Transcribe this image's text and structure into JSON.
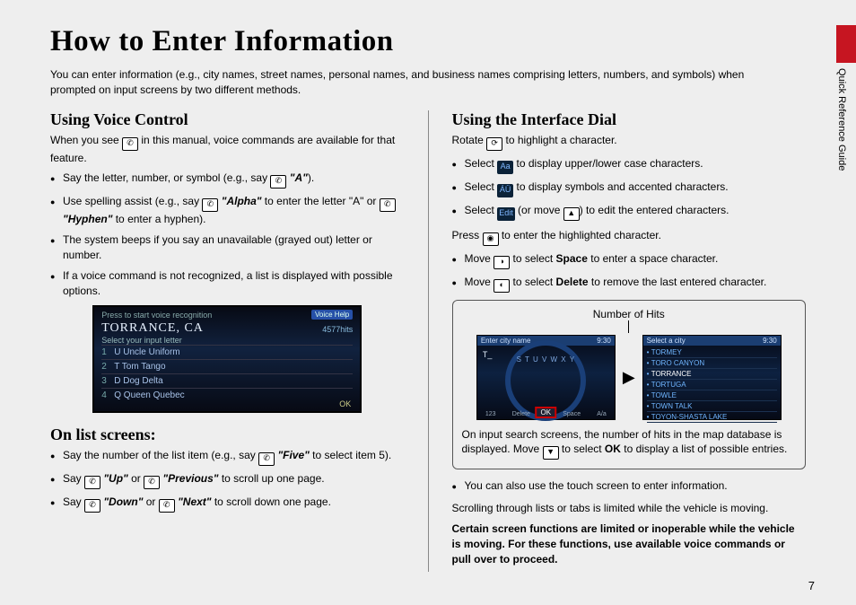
{
  "tab_label": "Quick Reference Guide",
  "page_number": "7",
  "title": "How to Enter Information",
  "intro": "You can enter information (e.g., city names, street names, personal names, and business names comprising letters, numbers, and symbols) when prompted on input screens by two different methods.",
  "left": {
    "h_voice": "Using Voice Control",
    "voice_intro_a": "When you see ",
    "voice_intro_b": " in this manual, voice commands are available for that feature.",
    "vb1_a": "Say the letter, number, or symbol (e.g., say ",
    "vb1_cmd": "\"A\"",
    "vb1_b": ").",
    "vb2_a": "Use spelling assist (e.g., say ",
    "vb2_cmd1": "\"Alpha\"",
    "vb2_mid": " to enter the letter \"A\" or ",
    "vb2_cmd2": "\"Hyphen\"",
    "vb2_b": " to enter a hyphen).",
    "vb3": "The system beeps if you say an unavailable (grayed out) letter or number.",
    "vb4": "If a voice command is not recognized, a list is displayed with possible options.",
    "shot": {
      "bar": "Press    to start voice recognition",
      "voice_help": "Voice Help",
      "city": "TORRANCE, CA",
      "hits": "4577hits",
      "sub": "Select your input letter",
      "rows": [
        {
          "n": "1",
          "t": "U Uncle Uniform"
        },
        {
          "n": "2",
          "t": "T Tom Tango"
        },
        {
          "n": "3",
          "t": "D Dog Delta"
        },
        {
          "n": "4",
          "t": "Q Queen Quebec"
        }
      ],
      "ok": "OK"
    },
    "h_list": "On list screens:",
    "lb1_a": "Say the number of the list item (e.g., say ",
    "lb1_cmd": "\"Five\"",
    "lb1_b": " to select item 5).",
    "lb2_a": "Say ",
    "lb2_cmd1": "\"Up\"",
    "lb2_mid": " or ",
    "lb2_cmd2": "\"Previous\"",
    "lb2_b": " to scroll up one page.",
    "lb3_a": "Say ",
    "lb3_cmd1": "\"Down\"",
    "lb3_mid": " or ",
    "lb3_cmd2": "\"Next\"",
    "lb3_b": " to scroll down one page."
  },
  "right": {
    "h_dial": "Using the Interface Dial",
    "p_rotate_a": "Rotate ",
    "p_rotate_b": " to highlight a character.",
    "db1_a": "Select ",
    "db1_b": " to display upper/lower case characters.",
    "db2_a": "Select ",
    "db2_b": " to display symbols and accented characters.",
    "db3_a": "Select ",
    "db3_mid": " (or move ",
    "db3_b": ") to edit the entered characters.",
    "p_press_a": "Press ",
    "p_press_b": " to enter the highlighted character.",
    "db4_a": "Move ",
    "db4_mid": " to select ",
    "db4_word": "Space",
    "db4_b": " to enter a space character.",
    "db5_a": "Move ",
    "db5_mid": " to select ",
    "db5_word": "Delete",
    "db5_b": " to remove the last entered character.",
    "diag_label": "Number of Hits",
    "shot_left": {
      "top": "Enter city name",
      "time": "9:30",
      "entered": "T_",
      "letters": "S  T  U  V  W  X  Y",
      "btm": [
        "123",
        "Delete",
        "OK",
        "Space",
        "A/a"
      ],
      "ok": "OK"
    },
    "shot_right": {
      "top": "Select a city",
      "time": "9:30",
      "items": [
        "TORMEY",
        "TORO CANYON",
        "TORRANCE",
        "TORTUGA",
        "TOWLE",
        "TOWN TALK",
        "TOYON-SHASTA LAKE"
      ]
    },
    "diag_note_a": "On input search screens, the number of hits in the map database is displayed. Move ",
    "diag_note_b": " to select ",
    "diag_note_ok": "OK",
    "diag_note_c": " to display a list of possible entries.",
    "touch": "You can also use the touch screen to enter information.",
    "scroll_limit": "Scrolling through lists or tabs is limited while the vehicle is moving.",
    "warn": "Certain screen functions are limited or inoperable while the vehicle is moving. For these functions, use available voice commands or pull over to proceed."
  }
}
